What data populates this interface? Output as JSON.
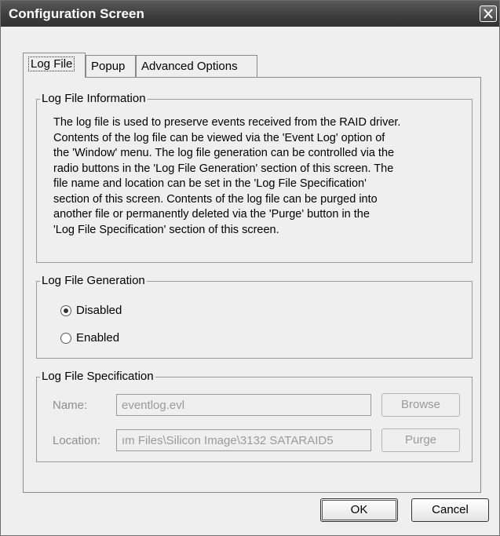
{
  "window": {
    "title": "Configuration Screen",
    "close_icon": "close-icon"
  },
  "tabs": [
    {
      "label": "Log File",
      "active": true
    },
    {
      "label": "Popup",
      "active": false
    },
    {
      "label": "Advanced Options",
      "active": false
    }
  ],
  "info_group": {
    "legend": "Log File Information",
    "lines": [
      "The log file is used to preserve events received from the RAID driver.",
      "Contents of the log file can be viewed via the 'Event Log' option of",
      "the 'Window' menu. The log file generation can be controlled via the",
      "radio buttons in the 'Log File Generation' section of this screen. The",
      "file name and location can be set in  the  'Log File Specification'",
      "section of this screen.  Contents of the log file can be purged into",
      "another file  or  permanently deleted via the 'Purge' button in the",
      "'Log File Specification' section of this screen."
    ]
  },
  "generation_group": {
    "legend": "Log File Generation",
    "options": [
      {
        "label": "Disabled",
        "checked": true
      },
      {
        "label": "Enabled",
        "checked": false
      }
    ]
  },
  "spec_group": {
    "legend": "Log File Specification",
    "name_label": "Name:",
    "name_value": "eventlog.evl",
    "location_label": "Location:",
    "location_value": "ım Files\\Silicon Image\\3132 SATARAID5",
    "browse_label": "Browse",
    "purge_label": "Purge",
    "enabled": false
  },
  "footer": {
    "ok_label": "OK",
    "cancel_label": "Cancel"
  }
}
